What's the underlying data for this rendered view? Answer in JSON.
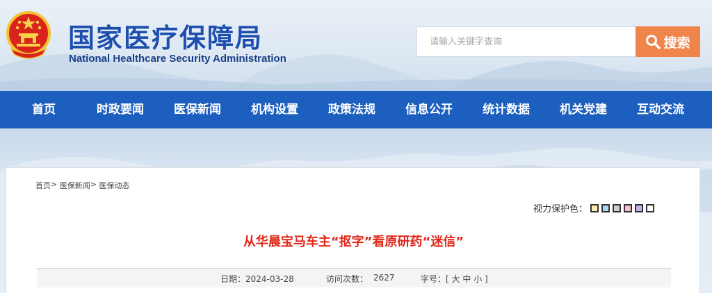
{
  "header": {
    "title_cn": "国家医疗保障局",
    "title_en": "National Healthcare Security Administration"
  },
  "search": {
    "placeholder": "请输入关键字查询",
    "button_label": "搜索"
  },
  "nav": {
    "items": [
      "首页",
      "时政要闻",
      "医保新闻",
      "机构设置",
      "政策法规",
      "信息公开",
      "统计数据",
      "机关党建",
      "互动交流"
    ]
  },
  "breadcrumb": {
    "items": [
      "首页",
      "医保新闻",
      "医保动态"
    ],
    "separator": ">"
  },
  "eye_care": {
    "label": "视力保护色：",
    "swatches": [
      "#fbf0b3",
      "#a8d8f0",
      "#cfcfcf",
      "#f5c2d3",
      "#c9b0e8",
      "#ffffff"
    ]
  },
  "article": {
    "title": "从华晨宝马车主“抠字”看原研药“迷信”",
    "date_label": "日期：2024-03-28",
    "visits_label": "访问次数：",
    "visits_value": "2627",
    "font_size_label": "字号：[",
    "font_size_large": "大",
    "font_size_medium": "中",
    "font_size_small": "小",
    "font_size_close": "]"
  },
  "colors": {
    "brand_blue": "#1c5fbf",
    "search_orange": "#f0854b",
    "title_red": "#e0281a"
  }
}
